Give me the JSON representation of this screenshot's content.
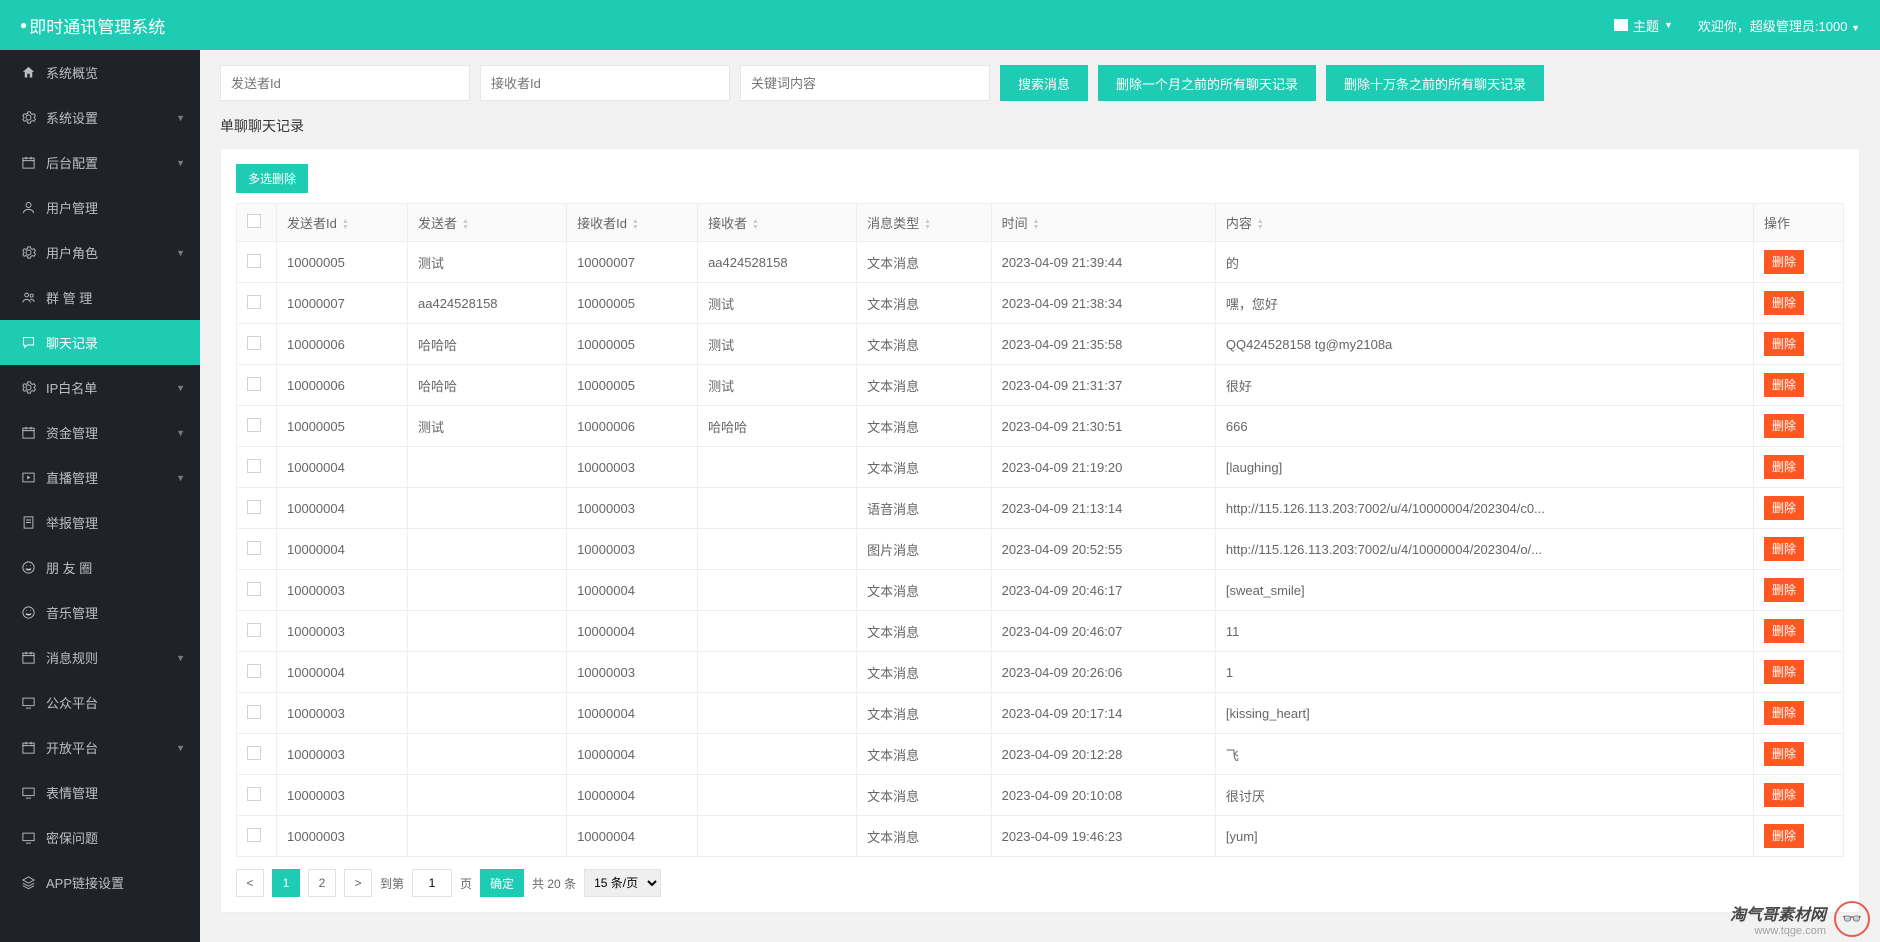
{
  "header": {
    "title": "即时通讯管理系统",
    "theme_label": "主题",
    "welcome_text": "欢迎你，超级管理员:1000"
  },
  "sidebar": {
    "items": [
      {
        "label": "系统概览",
        "icon": "home",
        "expand": false
      },
      {
        "label": "系统设置",
        "icon": "gear",
        "expand": true
      },
      {
        "label": "后台配置",
        "icon": "calendar",
        "expand": true
      },
      {
        "label": "用户管理",
        "icon": "user",
        "expand": false
      },
      {
        "label": "用户角色",
        "icon": "gear",
        "expand": true
      },
      {
        "label": "群 管 理",
        "icon": "users",
        "expand": false
      },
      {
        "label": "聊天记录",
        "icon": "chat",
        "expand": false,
        "active": true
      },
      {
        "label": "IP白名单",
        "icon": "gear",
        "expand": true
      },
      {
        "label": "资金管理",
        "icon": "calendar",
        "expand": true
      },
      {
        "label": "直播管理",
        "icon": "play",
        "expand": true
      },
      {
        "label": "举报管理",
        "icon": "report",
        "expand": false
      },
      {
        "label": "朋 友 圈",
        "icon": "smile",
        "expand": false
      },
      {
        "label": "音乐管理",
        "icon": "smile",
        "expand": false
      },
      {
        "label": "消息规则",
        "icon": "calendar",
        "expand": true
      },
      {
        "label": "公众平台",
        "icon": "screen",
        "expand": false
      },
      {
        "label": "开放平台",
        "icon": "calendar",
        "expand": true
      },
      {
        "label": "表情管理",
        "icon": "screen",
        "expand": false
      },
      {
        "label": "密保问题",
        "icon": "screen",
        "expand": false
      },
      {
        "label": "APP链接设置",
        "icon": "layers",
        "expand": false
      }
    ]
  },
  "search": {
    "sender_placeholder": "发送者Id",
    "receiver_placeholder": "接收者Id",
    "keyword_placeholder": "关键词内容",
    "search_btn": "搜索消息",
    "delete_month_btn": "删除一个月之前的所有聊天记录",
    "delete_100k_btn": "删除十万条之前的所有聊天记录"
  },
  "section_title": "单聊聊天记录",
  "multi_delete_label": "多选删除",
  "table": {
    "headers": {
      "sender_id": "发送者Id",
      "sender": "发送者",
      "receiver_id": "接收者Id",
      "receiver": "接收者",
      "msg_type": "消息类型",
      "time": "时间",
      "content": "内容",
      "action": "操作"
    },
    "delete_label": "删除",
    "rows": [
      {
        "sid": "10000005",
        "sender": "测试",
        "rid": "10000007",
        "receiver": "aa424528158",
        "type": "文本消息",
        "time": "2023-04-09 21:39:44",
        "content": "的"
      },
      {
        "sid": "10000007",
        "sender": "aa424528158",
        "rid": "10000005",
        "receiver": "测试",
        "type": "文本消息",
        "time": "2023-04-09 21:38:34",
        "content": "嘿，您好"
      },
      {
        "sid": "10000006",
        "sender": "哈哈哈",
        "rid": "10000005",
        "receiver": "测试",
        "type": "文本消息",
        "time": "2023-04-09 21:35:58",
        "content": "QQ424528158 tg@my2108a"
      },
      {
        "sid": "10000006",
        "sender": "哈哈哈",
        "rid": "10000005",
        "receiver": "测试",
        "type": "文本消息",
        "time": "2023-04-09 21:31:37",
        "content": "很好"
      },
      {
        "sid": "10000005",
        "sender": "测试",
        "rid": "10000006",
        "receiver": "哈哈哈",
        "type": "文本消息",
        "time": "2023-04-09 21:30:51",
        "content": "666"
      },
      {
        "sid": "10000004",
        "sender": "",
        "rid": "10000003",
        "receiver": "",
        "type": "文本消息",
        "time": "2023-04-09 21:19:20",
        "content": "[laughing]"
      },
      {
        "sid": "10000004",
        "sender": "",
        "rid": "10000003",
        "receiver": "",
        "type": "语音消息",
        "time": "2023-04-09 21:13:14",
        "content": "http://115.126.113.203:7002/u/4/10000004/202304/c0..."
      },
      {
        "sid": "10000004",
        "sender": "",
        "rid": "10000003",
        "receiver": "",
        "type": "图片消息",
        "time": "2023-04-09 20:52:55",
        "content": "http://115.126.113.203:7002/u/4/10000004/202304/o/..."
      },
      {
        "sid": "10000003",
        "sender": "",
        "rid": "10000004",
        "receiver": "",
        "type": "文本消息",
        "time": "2023-04-09 20:46:17",
        "content": "[sweat_smile]"
      },
      {
        "sid": "10000003",
        "sender": "",
        "rid": "10000004",
        "receiver": "",
        "type": "文本消息",
        "time": "2023-04-09 20:46:07",
        "content": "11"
      },
      {
        "sid": "10000004",
        "sender": "",
        "rid": "10000003",
        "receiver": "",
        "type": "文本消息",
        "time": "2023-04-09 20:26:06",
        "content": "1"
      },
      {
        "sid": "10000003",
        "sender": "",
        "rid": "10000004",
        "receiver": "",
        "type": "文本消息",
        "time": "2023-04-09 20:17:14",
        "content": "[kissing_heart]"
      },
      {
        "sid": "10000003",
        "sender": "",
        "rid": "10000004",
        "receiver": "",
        "type": "文本消息",
        "time": "2023-04-09 20:12:28",
        "content": "飞"
      },
      {
        "sid": "10000003",
        "sender": "",
        "rid": "10000004",
        "receiver": "",
        "type": "文本消息",
        "time": "2023-04-09 20:10:08",
        "content": "很讨厌"
      },
      {
        "sid": "10000003",
        "sender": "",
        "rid": "10000004",
        "receiver": "",
        "type": "文本消息",
        "time": "2023-04-09 19:46:23",
        "content": "[yum]"
      }
    ]
  },
  "pagination": {
    "page1": "1",
    "page2": "2",
    "goto_label": "到第",
    "page_input": "1",
    "page_unit": "页",
    "confirm": "确定",
    "total": "共 20 条",
    "per_page": "15 条/页"
  },
  "watermark": {
    "line1": "淘气哥素材网",
    "line2": "www.tqge.com"
  }
}
